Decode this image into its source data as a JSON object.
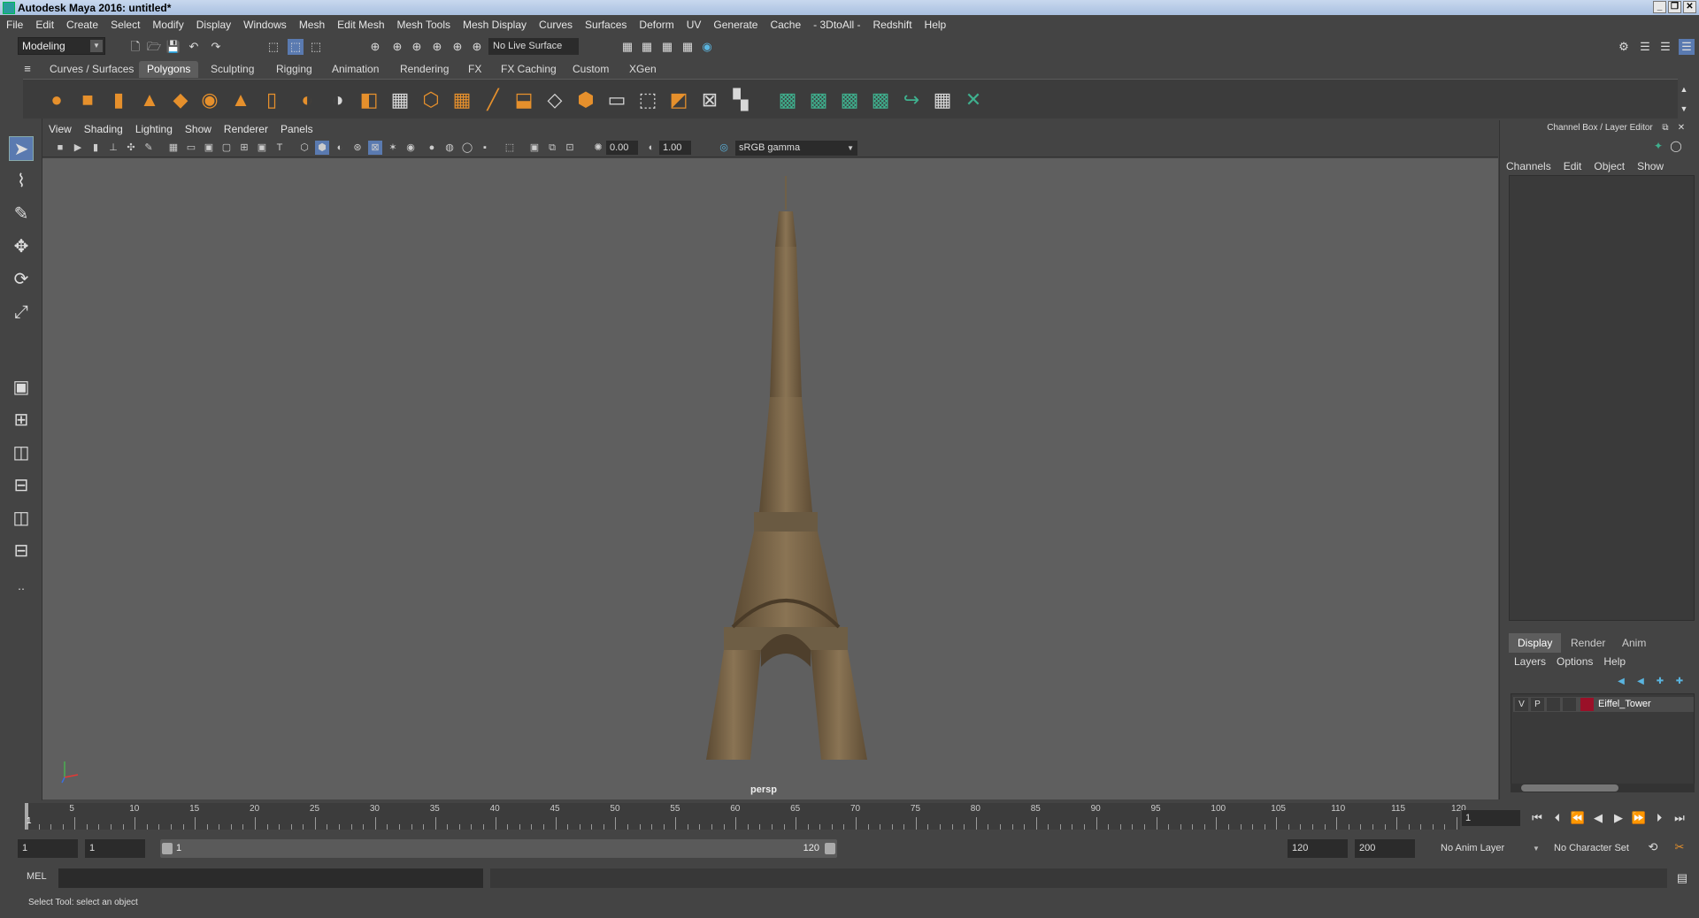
{
  "window": {
    "title": "Autodesk Maya 2016: untitled*",
    "controls": [
      "_",
      "❐",
      "✕"
    ]
  },
  "menubar": [
    "File",
    "Edit",
    "Create",
    "Select",
    "Modify",
    "Display",
    "Windows",
    "Mesh",
    "Edit Mesh",
    "Mesh Tools",
    "Mesh Display",
    "Curves",
    "Surfaces",
    "Deform",
    "UV",
    "Generate",
    "Cache",
    "- 3DtoAll -",
    "Redshift",
    "Help"
  ],
  "statusline": {
    "mode": "Modeling",
    "live_surface": "No Live Surface"
  },
  "shelf": {
    "tabs": [
      "Curves / Surfaces",
      "Polygons",
      "Sculpting",
      "Rigging",
      "Animation",
      "Rendering",
      "FX",
      "FX Caching",
      "Custom",
      "XGen"
    ],
    "active_tab": "Polygons"
  },
  "viewport": {
    "menu": [
      "View",
      "Shading",
      "Lighting",
      "Show",
      "Renderer",
      "Panels"
    ],
    "exposure": "0.00",
    "gamma": "1.00",
    "color_space": "sRGB gamma",
    "camera": "persp"
  },
  "channel_box": {
    "title": "Channel Box / Layer Editor",
    "menu": [
      "Channels",
      "Edit",
      "Object",
      "Show"
    ]
  },
  "layer_editor": {
    "tabs": [
      "Display",
      "Render",
      "Anim"
    ],
    "active_tab": "Display",
    "menu": [
      "Layers",
      "Options",
      "Help"
    ],
    "layers": [
      {
        "visible": "V",
        "playback": "P",
        "name": "Eiffel_Tower",
        "color": "#9a1028"
      }
    ]
  },
  "timeline": {
    "ticks": [
      "5",
      "10",
      "15",
      "20",
      "25",
      "30",
      "35",
      "40",
      "45",
      "50",
      "55",
      "60",
      "65",
      "70",
      "75",
      "80",
      "85",
      "90",
      "95",
      "100",
      "105",
      "110",
      "115",
      "120"
    ],
    "current_frame_marker": "1",
    "current_frame": "1"
  },
  "range": {
    "start": "1",
    "playback_start": "1",
    "slider_start": "1",
    "slider_end": "120",
    "playback_end": "120",
    "end": "200",
    "anim_layer": "No Anim Layer",
    "character_set": "No Character Set"
  },
  "command": {
    "label": "MEL"
  },
  "help_line": "Select Tool: select an object"
}
